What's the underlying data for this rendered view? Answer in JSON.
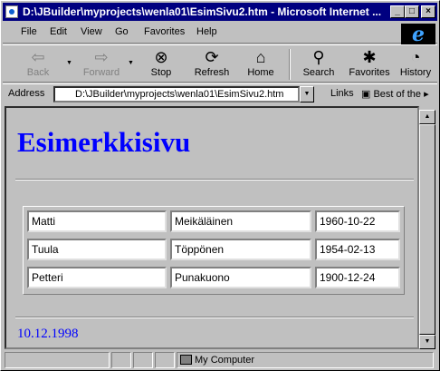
{
  "window": {
    "title": "D:\\JBuilder\\myprojects\\wenla01\\EsimSivu2.htm - Microsoft Internet ...",
    "minimize_glyph": "_",
    "maximize_glyph": "□",
    "close_glyph": "×"
  },
  "menu": {
    "file": "File",
    "edit": "Edit",
    "view": "View",
    "go": "Go",
    "favorites": "Favorites",
    "help": "Help"
  },
  "toolbar": {
    "back": {
      "label": "Back",
      "icon": "back-arrow-icon",
      "glyph": "⇦"
    },
    "forward": {
      "label": "Forward",
      "icon": "forward-arrow-icon",
      "glyph": "⇨"
    },
    "stop": {
      "label": "Stop",
      "icon": "stop-icon",
      "glyph": "⊗"
    },
    "refresh": {
      "label": "Refresh",
      "icon": "refresh-icon",
      "glyph": "⟳"
    },
    "home": {
      "label": "Home",
      "icon": "home-icon",
      "glyph": "⌂"
    },
    "search": {
      "label": "Search",
      "icon": "search-icon",
      "glyph": "⚲"
    },
    "favorites": {
      "label": "Favorites",
      "icon": "favorites-icon",
      "glyph": "✱"
    },
    "history": {
      "label": "History",
      "icon": "history-icon",
      "glyph": "◔"
    }
  },
  "address": {
    "label": "Address",
    "value": "D:\\JBuilder\\myprojects\\wenla01\\EsimSivu2.htm",
    "links_label": "Links",
    "best_of": "Best of the"
  },
  "page": {
    "heading": "Esimerkkisivu",
    "rows": [
      [
        "Matti",
        "Meikäläinen",
        "1960-10-22"
      ],
      [
        "Tuula",
        "Töppönen",
        "1954-02-13"
      ],
      [
        "Petteri",
        "Punakuono",
        "1900-12-24"
      ]
    ],
    "date": "10.12.1998"
  },
  "status": {
    "zone": "My Computer"
  },
  "colors": {
    "title_bar": "#000080",
    "link_blue": "#0000ff",
    "chrome": "#c0c0c0"
  }
}
